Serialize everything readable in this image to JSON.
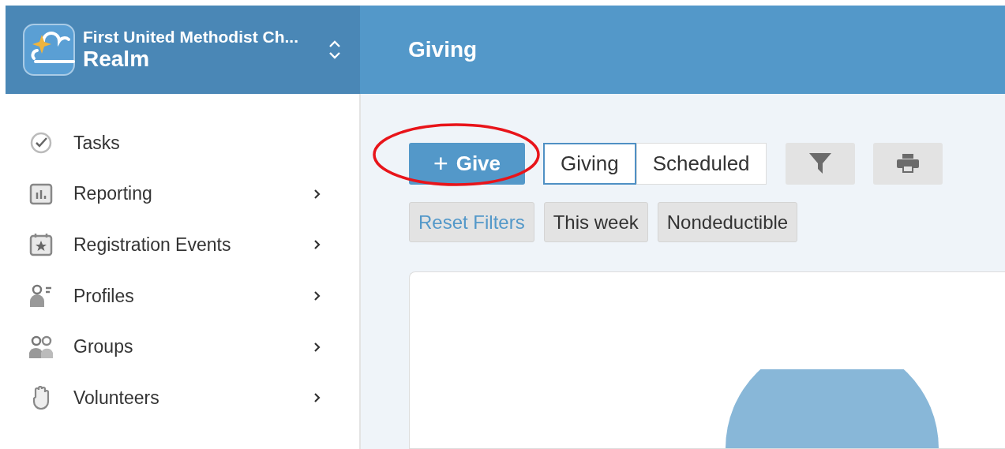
{
  "org": {
    "name": "First United Methodist Ch...",
    "product": "Realm"
  },
  "page_title": "Giving",
  "sidebar": {
    "items": [
      {
        "label": "Tasks",
        "kind": "tasks",
        "has_submenu": false
      },
      {
        "label": "Reporting",
        "kind": "reporting",
        "has_submenu": true
      },
      {
        "label": "Registration Events",
        "kind": "events",
        "has_submenu": true
      },
      {
        "label": "Profiles",
        "kind": "profiles",
        "has_submenu": true
      },
      {
        "label": "Groups",
        "kind": "groups",
        "has_submenu": true
      },
      {
        "label": "Volunteers",
        "kind": "volunteers",
        "has_submenu": true
      }
    ]
  },
  "toolbar": {
    "give_button": {
      "icon": "+",
      "label": "Give"
    },
    "tabs": [
      {
        "label": "Giving",
        "selected": true
      },
      {
        "label": "Scheduled",
        "selected": false
      }
    ]
  },
  "filters": [
    {
      "label": "Reset Filters",
      "kind": "reset"
    },
    {
      "label": "This week",
      "kind": "filter"
    },
    {
      "label": "Nondeductible",
      "kind": "filter"
    }
  ]
}
